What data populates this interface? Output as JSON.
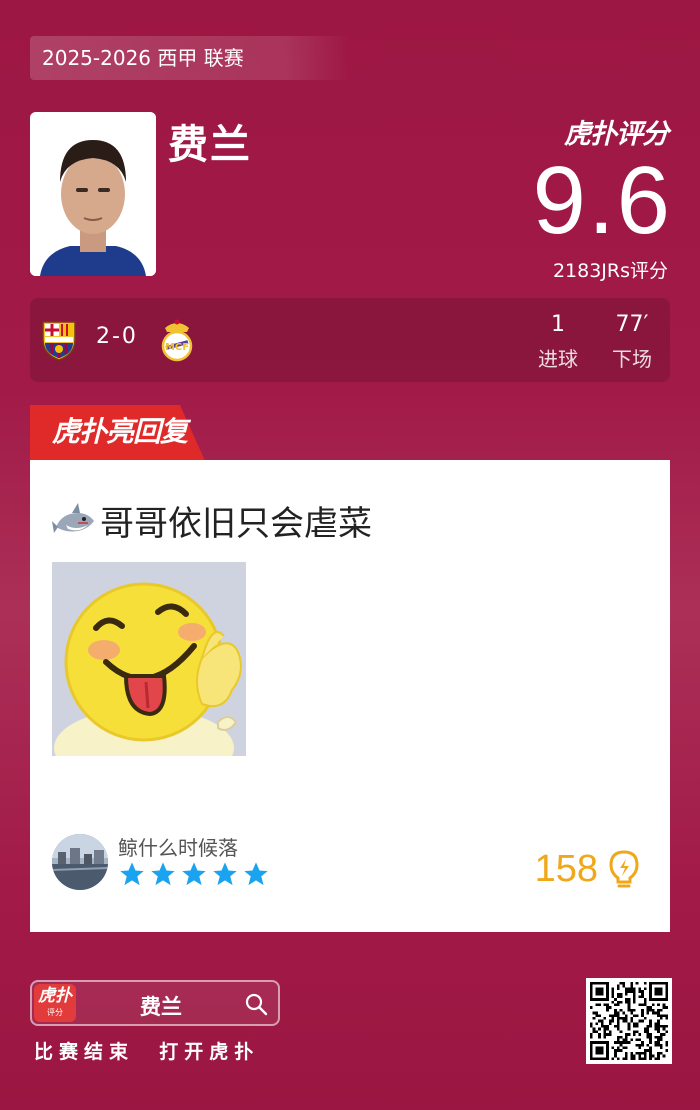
{
  "header": {
    "season_label": "2025-2026 西甲 联赛"
  },
  "player": {
    "name": "费兰"
  },
  "rating": {
    "brand": "虎扑评分",
    "score": "9.6",
    "count_label": "2183JRs评分"
  },
  "match": {
    "home_badge": "barcelona-crest-icon",
    "away_badge": "real-madrid-crest-icon",
    "score": "2-0",
    "stats": [
      {
        "value": "1",
        "label": "进球"
      },
      {
        "value": "77′",
        "label": "下场"
      }
    ]
  },
  "highlight": {
    "tab_label": "虎扑亮回复",
    "comment_text": "哥哥依旧只会虐菜",
    "user_name": "鲸什么时候落",
    "star_count": 5,
    "likes": "158"
  },
  "footer": {
    "app_icon_line1": "虎扑",
    "app_icon_line2": "评分",
    "search_text": "费兰",
    "caption": "比赛结束  打开虎扑"
  },
  "colors": {
    "background": "#9d1744",
    "accent_red": "#e23b3b",
    "star_blue": "#1aa3f0",
    "like_orange": "#f0a81a"
  }
}
